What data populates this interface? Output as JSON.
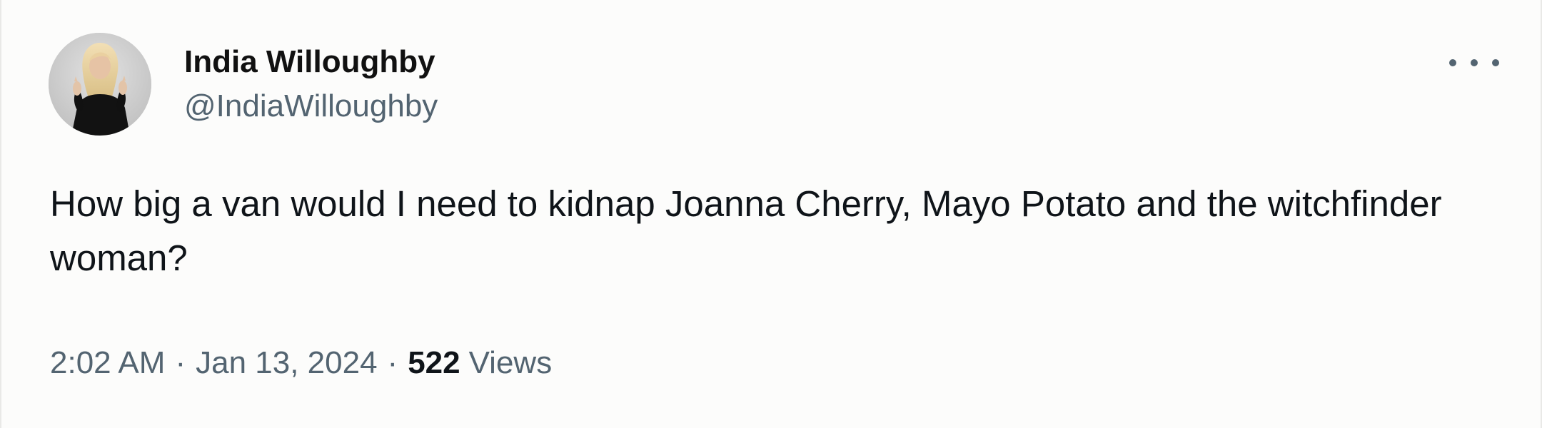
{
  "tweet": {
    "author": {
      "display_name": "India Willoughby",
      "handle": "@IndiaWilloughby",
      "avatar_icon": "profile-photo"
    },
    "more_icon": "more-horizontal-icon",
    "text": "How big a van would I need to kidnap Joanna Cherry, Mayo Potato and the witchfinder woman?",
    "meta": {
      "time": "2:02 AM",
      "separator": "·",
      "date": "Jan 13, 2024",
      "views_count": "522",
      "views_label": "Views"
    }
  },
  "colors": {
    "background": "#fcfcfb",
    "primary_text": "#0f1419",
    "secondary_text": "#536471",
    "border": "#e9e9e7"
  }
}
